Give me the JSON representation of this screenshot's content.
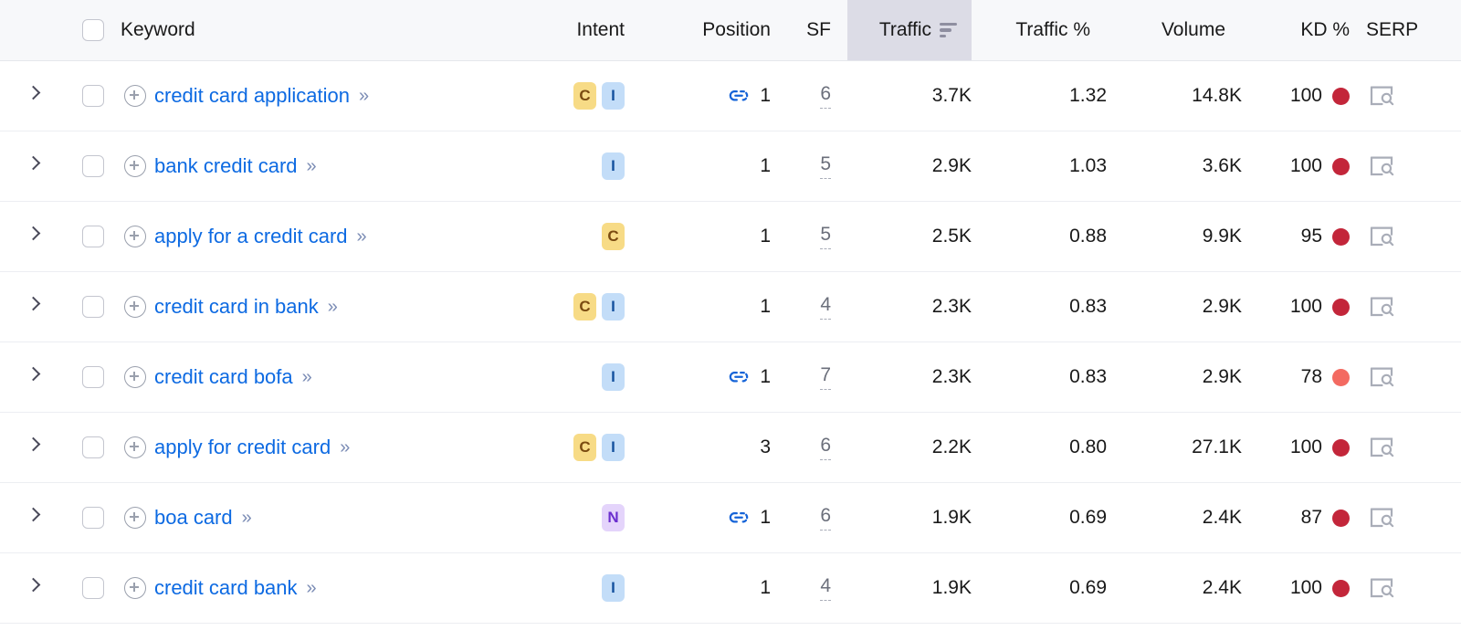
{
  "table": {
    "columns": [
      {
        "key": "expander",
        "label": ""
      },
      {
        "key": "select",
        "label": ""
      },
      {
        "key": "keyword",
        "label": "Keyword"
      },
      {
        "key": "intent",
        "label": "Intent"
      },
      {
        "key": "position",
        "label": "Position"
      },
      {
        "key": "sf",
        "label": "SF"
      },
      {
        "key": "traffic",
        "label": "Traffic"
      },
      {
        "key": "traffic_pct",
        "label": "Traffic %"
      },
      {
        "key": "volume",
        "label": "Volume"
      },
      {
        "key": "kd",
        "label": "KD %"
      },
      {
        "key": "serp",
        "label": "SERP"
      }
    ],
    "sorted_column": "Traffic",
    "sort_icon": "sort-descending-icon",
    "select_all_checkbox": {
      "checked": false
    },
    "rows": [
      {
        "keyword": "credit card application",
        "intents": [
          "C",
          "I"
        ],
        "has_link_icon": true,
        "position": "1",
        "sf": "6",
        "traffic": "3.7K",
        "traffic_pct": "1.32",
        "volume": "14.8K",
        "kd": "100",
        "kd_color": "#c3263a",
        "checked": false
      },
      {
        "keyword": "bank credit card",
        "intents": [
          "I"
        ],
        "has_link_icon": false,
        "position": "1",
        "sf": "5",
        "traffic": "2.9K",
        "traffic_pct": "1.03",
        "volume": "3.6K",
        "kd": "100",
        "kd_color": "#c3263a",
        "checked": false
      },
      {
        "keyword": "apply for a credit card",
        "intents": [
          "C"
        ],
        "has_link_icon": false,
        "position": "1",
        "sf": "5",
        "traffic": "2.5K",
        "traffic_pct": "0.88",
        "volume": "9.9K",
        "kd": "95",
        "kd_color": "#c3263a",
        "checked": false
      },
      {
        "keyword": "credit card in bank",
        "intents": [
          "C",
          "I"
        ],
        "has_link_icon": false,
        "position": "1",
        "sf": "4",
        "traffic": "2.3K",
        "traffic_pct": "0.83",
        "volume": "2.9K",
        "kd": "100",
        "kd_color": "#c3263a",
        "checked": false
      },
      {
        "keyword": "credit card bofa",
        "intents": [
          "I"
        ],
        "has_link_icon": true,
        "position": "1",
        "sf": "7",
        "traffic": "2.3K",
        "traffic_pct": "0.83",
        "volume": "2.9K",
        "kd": "78",
        "kd_color": "#f36a61",
        "checked": false
      },
      {
        "keyword": "apply for credit card",
        "intents": [
          "C",
          "I"
        ],
        "has_link_icon": false,
        "position": "3",
        "sf": "6",
        "traffic": "2.2K",
        "traffic_pct": "0.80",
        "volume": "27.1K",
        "kd": "100",
        "kd_color": "#c3263a",
        "checked": false
      },
      {
        "keyword": "boa card",
        "intents": [
          "N"
        ],
        "has_link_icon": true,
        "position": "1",
        "sf": "6",
        "traffic": "1.9K",
        "traffic_pct": "0.69",
        "volume": "2.4K",
        "kd": "87",
        "kd_color": "#c3263a",
        "checked": false
      },
      {
        "keyword": "credit card bank",
        "intents": [
          "I"
        ],
        "has_link_icon": false,
        "position": "1",
        "sf": "4",
        "traffic": "1.9K",
        "traffic_pct": "0.69",
        "volume": "2.4K",
        "kd": "100",
        "kd_color": "#c3263a",
        "checked": false
      }
    ]
  },
  "icons": {
    "expander": "chevron-right-icon",
    "add_keyword": "plus-circle-icon",
    "keyword_detail": "double-chevron-right-icon",
    "position_link": "link-icon",
    "serp": "serp-preview-icon"
  },
  "colors": {
    "link": "#0d6ae2",
    "header_bg": "#f7f8fa",
    "sorted_col_bg": "#dcdce6",
    "row_border": "#eceef2",
    "intent_commercial_bg": "#f7db86",
    "intent_informational_bg": "#c3ddf8",
    "intent_navigational_bg": "#e4d4fb"
  }
}
